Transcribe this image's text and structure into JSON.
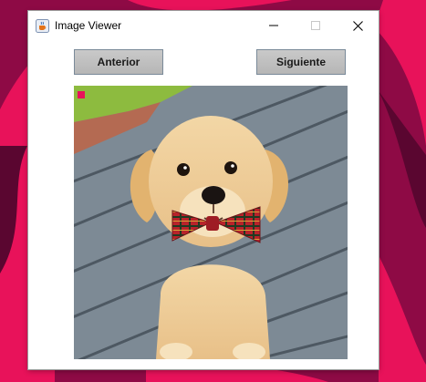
{
  "colors": {
    "desktop_background": "#8e0a45",
    "desktop_accent": "#e8125a",
    "window_background": "#ffffff",
    "button_background": "#bdbdbd"
  },
  "window": {
    "title": "Image Viewer",
    "app_icon": "java-coffee-cup-icon",
    "controls": {
      "minimize_icon": "minimize-icon",
      "maximize_icon": "maximize-icon",
      "close_icon": "close-icon"
    }
  },
  "toolbar": {
    "prev_label": "Anterior",
    "next_label": "Siguiente"
  },
  "image": {
    "subject": "golden-retriever-puppy-with-plaid-bow-tie-on-wooden-deck"
  }
}
